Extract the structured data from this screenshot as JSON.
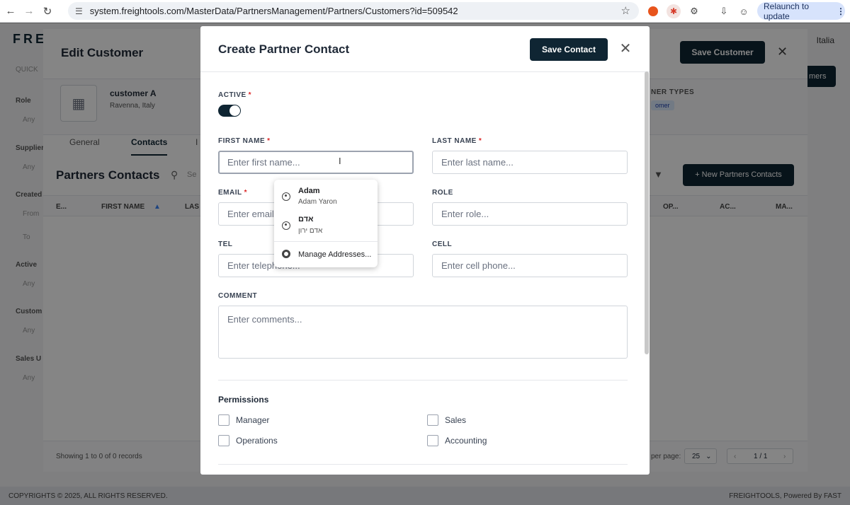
{
  "browser": {
    "url": "system.freightools.com/MasterData/PartnersManagement/Partners/Customers?id=509542",
    "relaunch_label": "Relaunch to update",
    "icons": [
      "back-icon",
      "forward-icon",
      "reload-icon",
      "site-settings-icon",
      "star-icon",
      "extension-icon",
      "download-icon",
      "profile-icon",
      "menu-icon"
    ]
  },
  "app": {
    "logo": "FRE",
    "top_right": "Italia",
    "filters": [
      {
        "label": "Role",
        "value": "Any"
      },
      {
        "label": "Supplier",
        "value": "Any"
      },
      {
        "label": "Created",
        "value": "From"
      },
      {
        "label": "",
        "value": "To"
      },
      {
        "label": "Active",
        "value": "Any"
      },
      {
        "label": "Custom",
        "value": "Any"
      },
      {
        "label": "Sales U",
        "value": "Any"
      }
    ],
    "quick_label": "QUICK",
    "footer_left": "COPYRIGHTS © 2025, ALL RIGHTS RESERVED.",
    "footer_right": "FREIGHTOOLS, Powered By FAST",
    "bg_button": "mers"
  },
  "edit_customer": {
    "title": "Edit Customer",
    "save_label": "Save Customer",
    "customer_name": "customer A",
    "customer_location": "Ravenna, Italy",
    "partner_types_label": "NER TYPES",
    "partner_type_tag": "omer",
    "tabs": [
      "General",
      "Contacts",
      "I"
    ],
    "contacts_title": "Partners Contacts",
    "new_contacts_label": "+ New Partners Contacts",
    "search_placeholder": "Se",
    "columns": [
      "E...",
      "FIRST NAME",
      "LAS",
      "OP...",
      "AC...",
      "MA..."
    ],
    "showing": "Showing 1 to 0 of 0 records",
    "per_page_label": "per page:",
    "per_page_value": "25",
    "page": "1 / 1"
  },
  "modal": {
    "title": "Create Partner Contact",
    "save_label": "Save Contact",
    "active_label": "ACTIVE",
    "active_on": true,
    "fields": {
      "first_name": {
        "label": "FIRST NAME",
        "placeholder": "Enter first name...",
        "required": true
      },
      "last_name": {
        "label": "LAST NAME",
        "placeholder": "Enter last name...",
        "required": true
      },
      "email": {
        "label": "EMAIL",
        "placeholder": "Enter email...",
        "required": true
      },
      "role": {
        "label": "ROLE",
        "placeholder": "Enter role..."
      },
      "tel": {
        "label": "TEL",
        "placeholder": "Enter telephone..."
      },
      "cell": {
        "label": "CELL",
        "placeholder": "Enter cell phone..."
      },
      "comment": {
        "label": "COMMENT",
        "placeholder": "Enter comments..."
      }
    },
    "required_mark": "*",
    "permissions_title": "Permissions",
    "permissions": [
      {
        "label": "Manager",
        "checked": false
      },
      {
        "label": "Sales",
        "checked": false
      },
      {
        "label": "Operations",
        "checked": false
      },
      {
        "label": "Accounting",
        "checked": false
      }
    ]
  },
  "autofill": {
    "suggestions": [
      {
        "main": "Adam",
        "sub": "Adam Yaron"
      },
      {
        "main": "אדם",
        "sub": "אדם ירון"
      }
    ],
    "manage_label": "Manage Addresses..."
  },
  "colors": {
    "primary": "#0f2533",
    "required": "#dc2626",
    "tag_bg": "#dbeafe"
  }
}
